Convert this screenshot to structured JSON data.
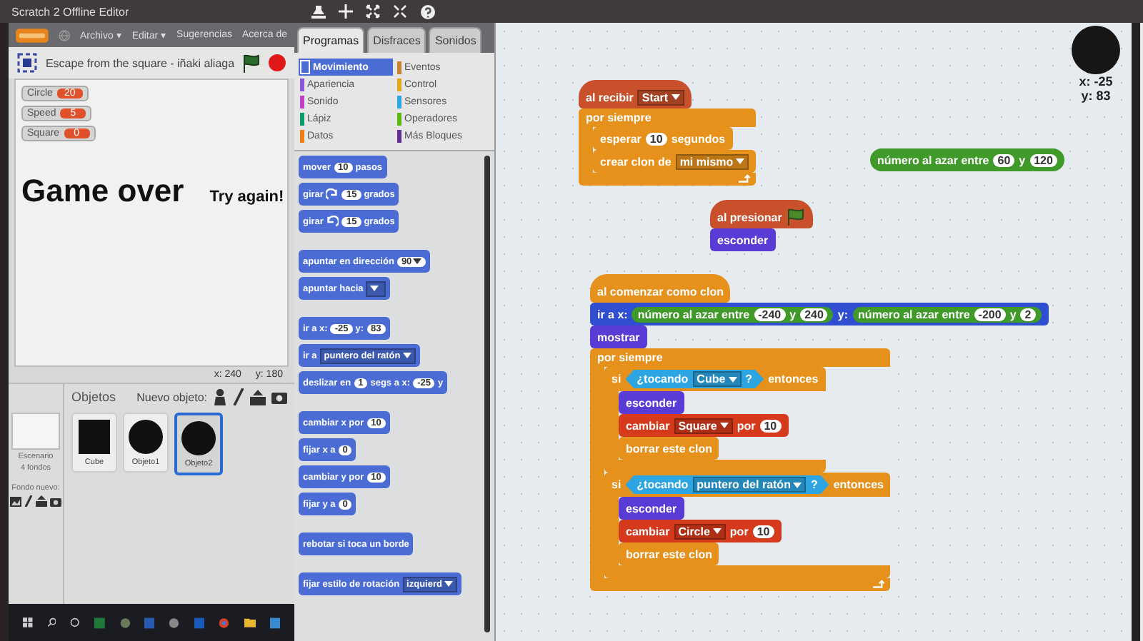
{
  "window": {
    "title": "Scratch 2 Offline Editor"
  },
  "menu": [
    "Archivo ▾",
    "Editar ▾",
    "Sugerencias",
    "Acerca de"
  ],
  "project": {
    "title": "Escape from the square - iñaki aliaga"
  },
  "stage": {
    "monitors": [
      {
        "name": "Circle",
        "value": "20"
      },
      {
        "name": "Speed",
        "value": "5"
      },
      {
        "name": "Square",
        "value": "0"
      }
    ],
    "headline": "Game over",
    "subline": "Try again!",
    "x": "x: 240",
    "y": "y: 180"
  },
  "sprites_pane": {
    "title": "Objetos",
    "new_label": "Nuevo objeto:",
    "stage_label": "Escenario",
    "backdrops": "4 fondos",
    "new_backdrop": "Fondo nuevo:",
    "sprites": [
      {
        "name": "Cube",
        "kind": "square",
        "selected": false
      },
      {
        "name": "Objeto1",
        "kind": "circle",
        "selected": false
      },
      {
        "name": "Objeto2",
        "kind": "circle",
        "selected": true
      }
    ]
  },
  "tabs": [
    {
      "label": "Programas",
      "selected": true
    },
    {
      "label": "Disfraces",
      "selected": false
    },
    {
      "label": "Sonidos",
      "selected": false
    }
  ],
  "categories": [
    {
      "label": "Movimiento",
      "color": "#4a6cd4",
      "selected": true
    },
    {
      "label": "Eventos",
      "color": "#c88330",
      "selected": false
    },
    {
      "label": "Apariencia",
      "color": "#8a55d7",
      "selected": false
    },
    {
      "label": "Control",
      "color": "#e1a91a",
      "selected": false
    },
    {
      "label": "Sonido",
      "color": "#bb42c3",
      "selected": false
    },
    {
      "label": "Sensores",
      "color": "#2ca5e2",
      "selected": false
    },
    {
      "label": "Lápiz",
      "color": "#0e9a6c",
      "selected": false
    },
    {
      "label": "Operadores",
      "color": "#5cb712",
      "selected": false
    },
    {
      "label": "Datos",
      "color": "#ee7d16",
      "selected": false
    },
    {
      "label": "Más Bloques",
      "color": "#632d99",
      "selected": false
    }
  ],
  "palette": [
    {
      "gap": false,
      "parts": [
        {
          "kind": "label",
          "text": "mover"
        },
        {
          "kind": "number",
          "text": "10"
        },
        {
          "kind": "label",
          "text": "pasos"
        }
      ]
    },
    {
      "gap": false,
      "parts": [
        {
          "kind": "label",
          "text": "girar"
        },
        {
          "kind": "turn_right"
        },
        {
          "kind": "number",
          "text": "15"
        },
        {
          "kind": "label",
          "text": "grados"
        }
      ]
    },
    {
      "gap": false,
      "parts": [
        {
          "kind": "label",
          "text": "girar"
        },
        {
          "kind": "turn_left"
        },
        {
          "kind": "number",
          "text": "15"
        },
        {
          "kind": "label",
          "text": "grados"
        }
      ]
    },
    {
      "gap": true,
      "parts": [
        {
          "kind": "label",
          "text": "apuntar en dirección"
        },
        {
          "kind": "numdrop",
          "text": "90"
        }
      ]
    },
    {
      "gap": false,
      "parts": [
        {
          "kind": "label",
          "text": "apuntar hacia"
        },
        {
          "kind": "dropdown"
        }
      ]
    },
    {
      "gap": true,
      "parts": [
        {
          "kind": "label",
          "text": "ir a x:"
        },
        {
          "kind": "number",
          "text": "-25"
        },
        {
          "kind": "label",
          "text": "y:"
        },
        {
          "kind": "number",
          "text": "83"
        }
      ]
    },
    {
      "gap": false,
      "parts": [
        {
          "kind": "label",
          "text": "ir a"
        },
        {
          "kind": "dropdown",
          "text": "puntero del ratón"
        }
      ]
    },
    {
      "gap": false,
      "parts": [
        {
          "kind": "label",
          "text": "deslizar en"
        },
        {
          "kind": "number",
          "text": "1"
        },
        {
          "kind": "label",
          "text": "segs a x:"
        },
        {
          "kind": "number",
          "text": "-25"
        },
        {
          "kind": "label",
          "text": "y"
        }
      ]
    },
    {
      "gap": true,
      "parts": [
        {
          "kind": "label",
          "text": "cambiar x por"
        },
        {
          "kind": "number",
          "text": "10"
        }
      ]
    },
    {
      "gap": false,
      "parts": [
        {
          "kind": "label",
          "text": "fijar x a"
        },
        {
          "kind": "number",
          "text": "0"
        }
      ]
    },
    {
      "gap": false,
      "parts": [
        {
          "kind": "label",
          "text": "cambiar y por"
        },
        {
          "kind": "number",
          "text": "10"
        }
      ]
    },
    {
      "gap": false,
      "parts": [
        {
          "kind": "label",
          "text": "fijar y a"
        },
        {
          "kind": "number",
          "text": "0"
        }
      ]
    },
    {
      "gap": true,
      "parts": [
        {
          "kind": "label",
          "text": "rebotar si toca un borde"
        }
      ]
    },
    {
      "gap": true,
      "parts": [
        {
          "kind": "label",
          "text": "fijar estilo de rotación"
        },
        {
          "kind": "dropdown",
          "text": "izquierd"
        }
      ]
    }
  ],
  "scripts": [
    {
      "blocks": [
        {
          "kind": "hat",
          "color": "#c8502a",
          "parts": [
            {
              "kind": "label",
              "text": "al recibir"
            },
            {
              "kind": "dropdown",
              "text": "Start"
            }
          ]
        },
        {
          "kind": "forever",
          "color": "#e6911c",
          "parts": [
            {
              "kind": "label",
              "text": "por siempre"
            }
          ],
          "children": [
            {
              "kind": "stack",
              "color": "#e6911c",
              "parts": [
                {
                  "kind": "label",
                  "text": "esperar"
                },
                {
                  "kind": "number",
                  "text": "10"
                },
                {
                  "kind": "label",
                  "text": "segundos"
                }
              ]
            },
            {
              "kind": "stack",
              "color": "#e6911c",
              "parts": [
                {
                  "kind": "label",
                  "text": "crear clon de"
                },
                {
                  "kind": "dropdown",
                  "text": "mi mismo"
                }
              ]
            }
          ]
        }
      ]
    },
    {
      "blocks": [
        {
          "kind": "reporter",
          "color": "#3f9a2a",
          "parts": [
            {
              "kind": "label",
              "text": "número al azar entre"
            },
            {
              "kind": "number",
              "text": "60"
            },
            {
              "kind": "label",
              "text": "y"
            },
            {
              "kind": "number",
              "text": "120"
            }
          ]
        }
      ]
    },
    {
      "blocks": [
        {
          "kind": "hat",
          "color": "#c8502a",
          "parts": [
            {
              "kind": "label",
              "text": "al presionar"
            },
            {
              "kind": "flag"
            }
          ]
        },
        {
          "kind": "stack",
          "color": "#5a3bd6",
          "parts": [
            {
              "kind": "label",
              "text": "esconder"
            }
          ]
        }
      ]
    },
    {
      "blocks": [
        {
          "kind": "hat",
          "color": "#e6911c",
          "parts": [
            {
              "kind": "label",
              "text": "al comenzar como clon"
            }
          ]
        },
        {
          "kind": "stack",
          "color": "#2f4fd0",
          "parts": [
            {
              "kind": "label",
              "text": "ir a x:"
            },
            {
              "kind": "reporter",
              "color": "#3f9a2a",
              "parts": [
                {
                  "kind": "label",
                  "text": "número al azar entre"
                },
                {
                  "kind": "number",
                  "text": "-240"
                },
                {
                  "kind": "label",
                  "text": "y"
                },
                {
                  "kind": "number",
                  "text": "240"
                }
              ]
            },
            {
              "kind": "label",
              "text": "y:"
            },
            {
              "kind": "reporter",
              "color": "#3f9a2a",
              "parts": [
                {
                  "kind": "label",
                  "text": "número al azar entre"
                },
                {
                  "kind": "number",
                  "text": "-200"
                },
                {
                  "kind": "label",
                  "text": "y"
                },
                {
                  "kind": "number",
                  "text": "2"
                }
              ]
            }
          ]
        },
        {
          "kind": "stack",
          "color": "#5a3bd6",
          "parts": [
            {
              "kind": "label",
              "text": "mostrar"
            }
          ]
        },
        {
          "kind": "forever",
          "color": "#e6911c",
          "parts": [
            {
              "kind": "label",
              "text": "por siempre"
            }
          ],
          "children": [
            {
              "kind": "if",
              "color": "#e6911c",
              "parts": [
                {
                  "kind": "label",
                  "text": "si"
                },
                {
                  "kind": "boolean",
                  "color": "#2ca5e2",
                  "parts": [
                    {
                      "kind": "label",
                      "text": "¿tocando"
                    },
                    {
                      "kind": "dropdown",
                      "text": "Cube"
                    },
                    {
                      "kind": "label",
                      "text": "?"
                    }
                  ]
                },
                {
                  "kind": "label",
                  "text": "entonces"
                }
              ],
              "children": [
                {
                  "kind": "stack",
                  "color": "#5a3bd6",
                  "parts": [
                    {
                      "kind": "label",
                      "text": "esconder"
                    }
                  ]
                },
                {
                  "kind": "stack",
                  "color": "#d63a1c",
                  "parts": [
                    {
                      "kind": "label",
                      "text": "cambiar"
                    },
                    {
                      "kind": "dropdown",
                      "text": "Square"
                    },
                    {
                      "kind": "label",
                      "text": "por"
                    },
                    {
                      "kind": "number",
                      "text": "10"
                    }
                  ]
                },
                {
                  "kind": "stack",
                  "color": "#e6911c",
                  "parts": [
                    {
                      "kind": "label",
                      "text": "borrar este clon"
                    }
                  ]
                }
              ]
            },
            {
              "kind": "if",
              "color": "#e6911c",
              "parts": [
                {
                  "kind": "label",
                  "text": "si"
                },
                {
                  "kind": "boolean",
                  "color": "#2ca5e2",
                  "parts": [
                    {
                      "kind": "label",
                      "text": "¿tocando"
                    },
                    {
                      "kind": "dropdown",
                      "text": "puntero del ratón"
                    },
                    {
                      "kind": "label",
                      "text": "?"
                    }
                  ]
                },
                {
                  "kind": "label",
                  "text": "entonces"
                }
              ],
              "children": [
                {
                  "kind": "stack",
                  "color": "#5a3bd6",
                  "parts": [
                    {
                      "kind": "label",
                      "text": "esconder"
                    }
                  ]
                },
                {
                  "kind": "stack",
                  "color": "#d63a1c",
                  "parts": [
                    {
                      "kind": "label",
                      "text": "cambiar"
                    },
                    {
                      "kind": "dropdown",
                      "text": "Circle"
                    },
                    {
                      "kind": "label",
                      "text": "por"
                    },
                    {
                      "kind": "number",
                      "text": "10"
                    }
                  ]
                },
                {
                  "kind": "stack",
                  "color": "#e6911c",
                  "parts": [
                    {
                      "kind": "label",
                      "text": "borrar este clon"
                    }
                  ]
                }
              ]
            }
          ]
        }
      ]
    }
  ],
  "sprite_info": {
    "x": "x: -25",
    "y": "y: 83"
  }
}
